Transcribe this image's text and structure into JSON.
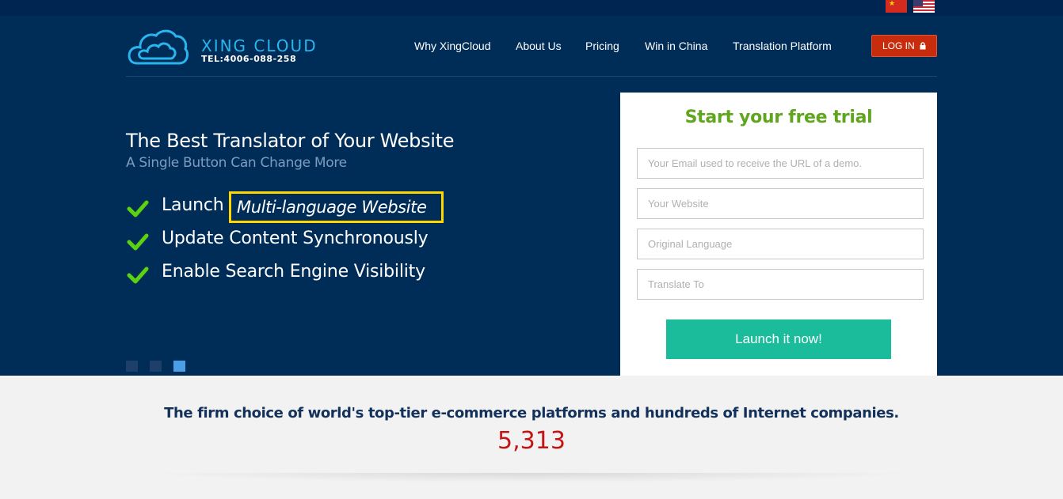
{
  "language_flags": [
    {
      "icon": "china-flag-icon"
    },
    {
      "icon": "usa-flag-icon"
    }
  ],
  "logo": {
    "name": "XING CLOUD",
    "tel": "TEL:4006-088-258",
    "icon": "cloud-logo-icon",
    "color": "#29b6ee"
  },
  "nav": {
    "items": [
      "Why XingCloud",
      "About Us",
      "Pricing",
      "Win in China",
      "Translation Platform"
    ],
    "login_label": "LOG IN",
    "login_icon": "lock-icon"
  },
  "hero": {
    "headline": "The Best Translator of Your Website",
    "subheadline": "A Single Button Can Change More",
    "features": [
      {
        "prefix": "Launch",
        "highlight": "Multi-language Website"
      },
      {
        "text": "Update Content Synchronously"
      },
      {
        "text": "Enable Search Engine Visibility"
      }
    ],
    "check_icon": "checkmark-icon",
    "slider": {
      "count": 3,
      "active_index": 2
    }
  },
  "trial_form": {
    "title": "Start your free trial",
    "fields": [
      {
        "placeholder": "Your Email used to receive the URL of a demo.",
        "value": ""
      },
      {
        "placeholder": "Your Website",
        "value": ""
      },
      {
        "placeholder": "Original Language",
        "value": ""
      },
      {
        "placeholder": "Translate To",
        "value": ""
      }
    ],
    "submit_label": "Launch it now!"
  },
  "stats": {
    "tagline": "The firm choice of world's top-tier e-commerce platforms and hundreds of Internet companies.",
    "count": "5,313"
  },
  "colors": {
    "hero_bg": "#002d58",
    "accent_green": "#5fa61e",
    "login_red": "#c72d0d",
    "launch_teal": "#1abc9c",
    "highlight_yellow": "#ffd600",
    "counter_red": "#c51414"
  }
}
